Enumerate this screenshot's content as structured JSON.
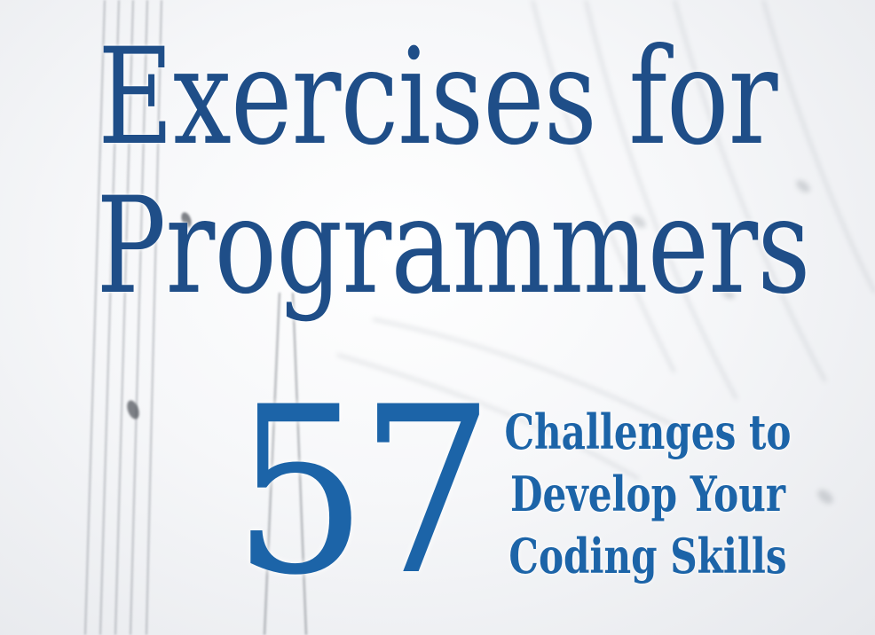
{
  "cover": {
    "title_line_1": "Exercises for",
    "title_line_2": "Programmers",
    "number": "57",
    "subtitle_lines": [
      "Challenges to",
      "Develop Your",
      "Coding Skills"
    ]
  },
  "colors": {
    "title": "#1f4e88",
    "accent": "#1c64a8",
    "background": "#f6f7f9",
    "staff_lines": "#8a8f96"
  },
  "background_art": "blurred-sheet-music"
}
